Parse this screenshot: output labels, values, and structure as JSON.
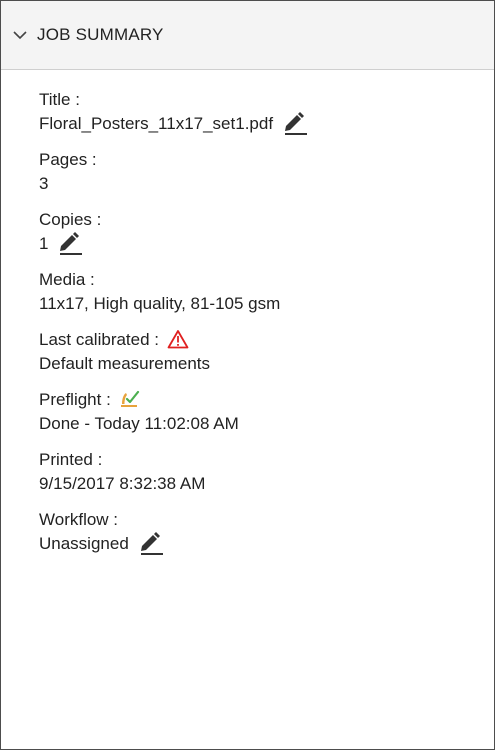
{
  "header": {
    "title": "JOB SUMMARY"
  },
  "fields": {
    "title": {
      "label": "Title :",
      "value": "Floral_Posters_11x17_set1.pdf"
    },
    "pages": {
      "label": "Pages :",
      "value": "3"
    },
    "copies": {
      "label": "Copies :",
      "value": "1"
    },
    "media": {
      "label": "Media :",
      "value": "11x17, High quality, 81-105 gsm"
    },
    "last_calibrated": {
      "label": "Last calibrated :",
      "value": "Default measurements"
    },
    "preflight": {
      "label": "Preflight :",
      "value": "Done - Today 11:02:08 AM"
    },
    "printed": {
      "label": "Printed :",
      "value": "9/15/2017 8:32:38 AM"
    },
    "workflow": {
      "label": "Workflow :",
      "value": "Unassigned"
    }
  },
  "icons": {
    "collapse": "chevron-down-icon",
    "edit": "pencil-icon",
    "warning": "warning-triangle-icon",
    "preflight_status": "checkmark-icon"
  },
  "colors": {
    "warning": "#e02020",
    "preflight_check": "#e8a33c",
    "preflight_tick": "#4caf50"
  }
}
